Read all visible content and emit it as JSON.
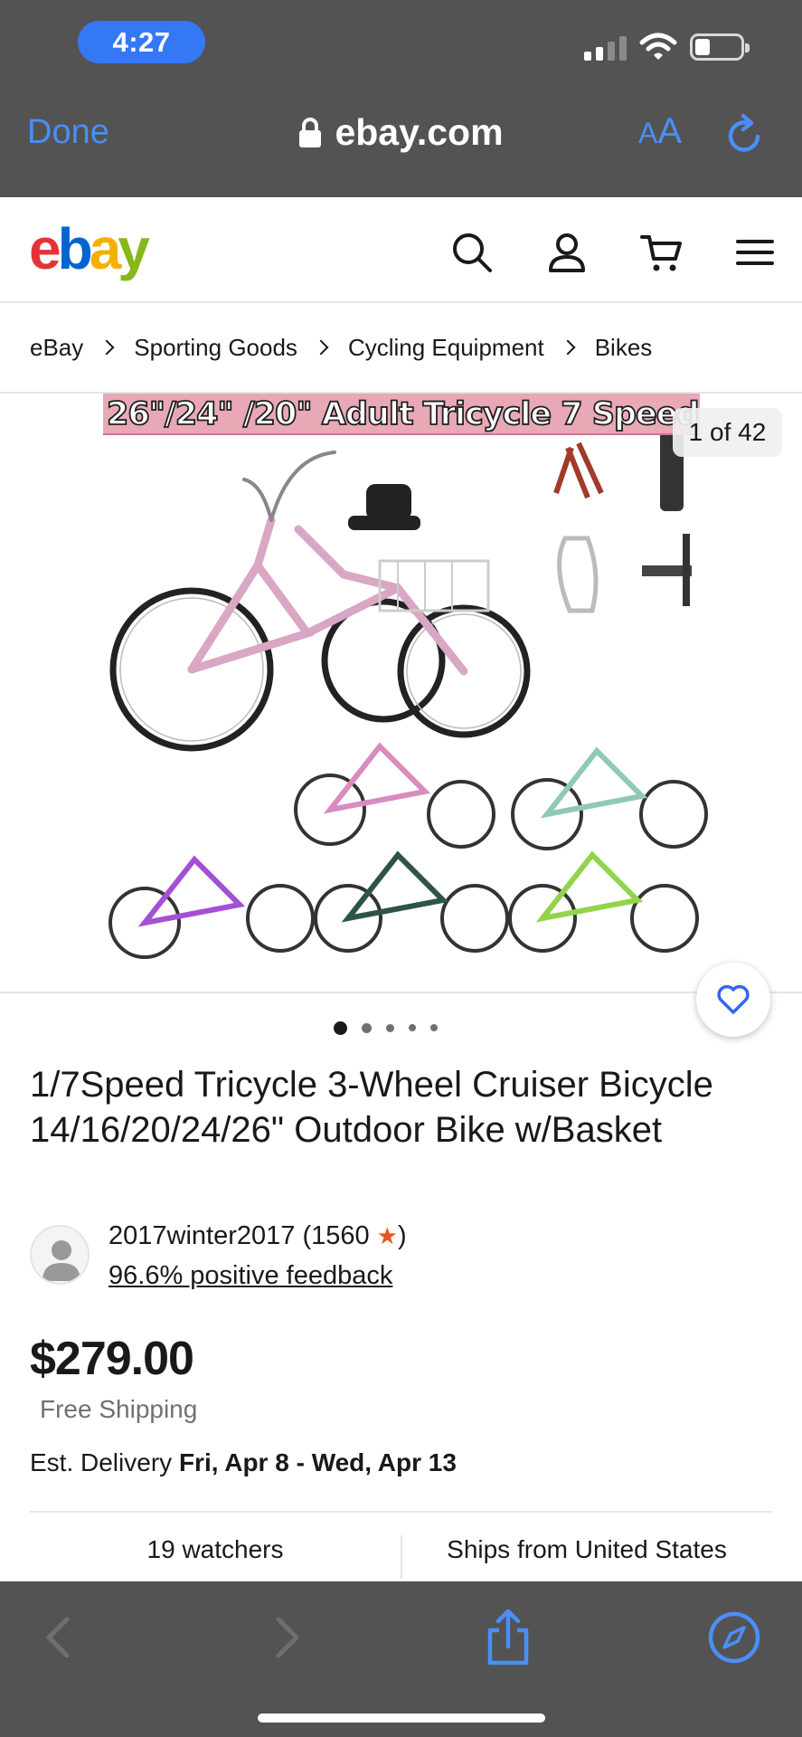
{
  "status_bar": {
    "time": "4:27"
  },
  "browser": {
    "done_label": "Done",
    "host": "ebay.com",
    "text_size_label_small": "A",
    "text_size_label_large": "A",
    "accent_color": "#4b8ef7",
    "chrome_color": "#535353"
  },
  "header": {
    "logo": {
      "e": "e",
      "b": "b",
      "a": "a",
      "y": "y"
    },
    "logo_colors": [
      "#e53238",
      "#0064d2",
      "#f5af02",
      "#86b817"
    ],
    "icons": [
      "search-icon",
      "account-icon",
      "cart-icon",
      "menu-icon"
    ]
  },
  "breadcrumb": [
    "eBay",
    "Sporting Goods",
    "Cycling Equipment",
    "Bikes"
  ],
  "gallery": {
    "banner_text": "26\"/24\" /20\" Adult Tricycle   7 Speed",
    "counter": "1 of 42",
    "dot_count": 5,
    "active_dot": 0
  },
  "listing": {
    "title": "1/7Speed Tricycle 3-Wheel Cruiser Bicycle 14/16/20/24/26\" Outdoor Bike w/Basket",
    "seller_name": "2017winter2017 (1560 ",
    "seller_name_end": ")",
    "seller_feedback": "96.6% positive feedback",
    "price": "$279.00",
    "shipping": "Free Shipping",
    "delivery_label": "Est. Delivery ",
    "delivery_dates": "Fri, Apr 8 - Wed, Apr 13",
    "watchers": "19 watchers",
    "ships_from": "Ships from United States"
  },
  "toolbar": {
    "icons": [
      "back-icon",
      "forward-icon",
      "share-icon",
      "compass-icon"
    ]
  }
}
